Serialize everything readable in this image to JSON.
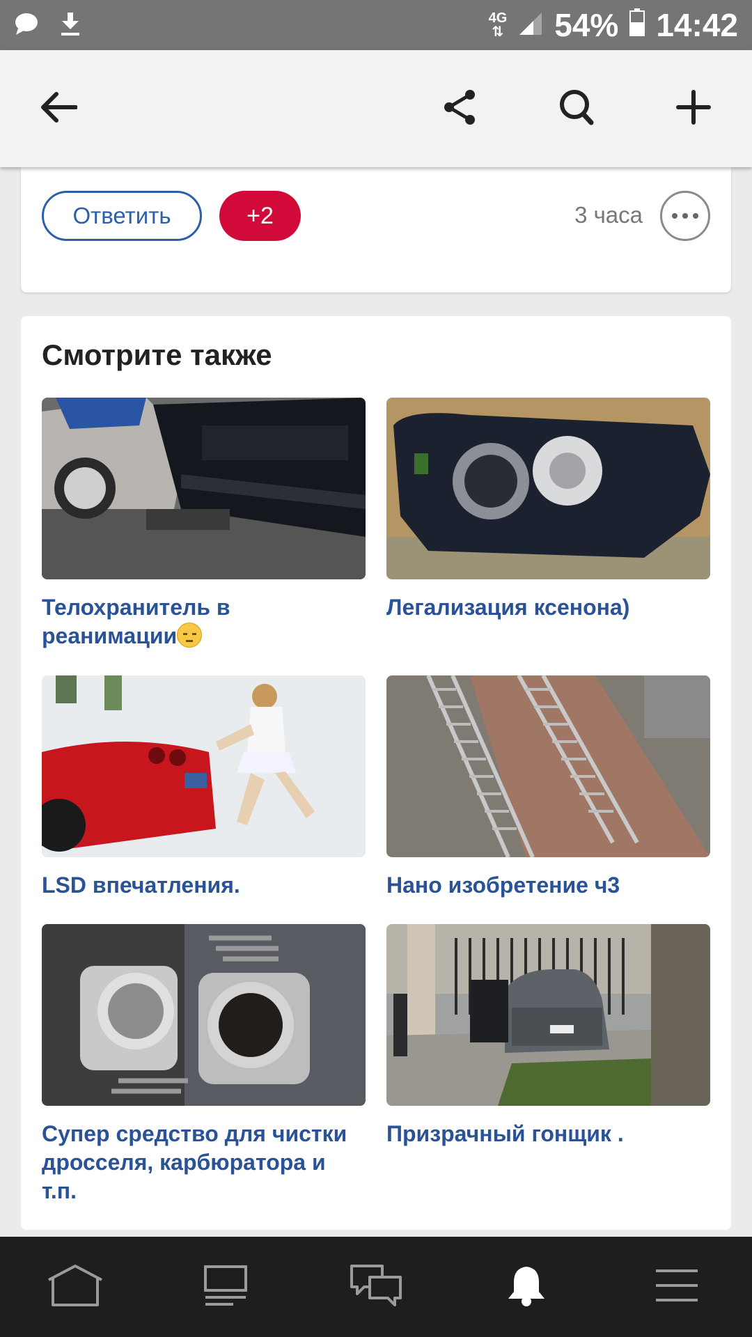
{
  "status_bar": {
    "network": "4G",
    "battery": "54%",
    "time": "14:42"
  },
  "comment": {
    "reply_label": "Ответить",
    "plus_count": "+2",
    "time": "3 часа"
  },
  "see_also": {
    "heading": "Смотрите также",
    "items": [
      {
        "title": "Телохранитель в реанимации"
      },
      {
        "title": "Легализация ксенона)"
      },
      {
        "title": "LSD впечатления."
      },
      {
        "title": "Нано изобретение ч3"
      },
      {
        "title": "Супер средство для чистки дросселя, карбюратора и т.п."
      },
      {
        "title": "Призрачный гонщик ."
      }
    ]
  },
  "colors": {
    "accent_blue": "#2a5296",
    "badge_red": "#d20a3a",
    "status_bar": "#757575",
    "bottom_nav": "#1e1e1e"
  }
}
